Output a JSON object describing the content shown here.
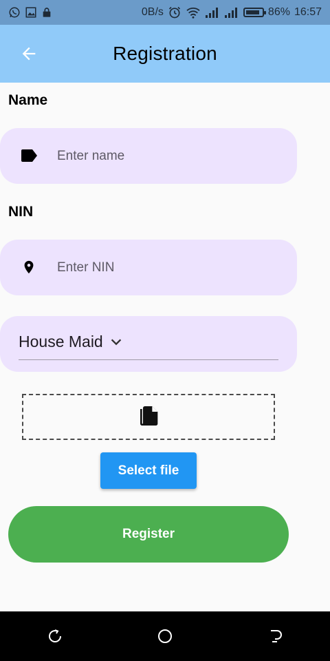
{
  "status_bar": {
    "network_speed": "0B/s",
    "battery_percent": "86%",
    "time": "16:57",
    "battery_level": 0.86
  },
  "app_bar": {
    "title": "Registration",
    "color": "#90caf9"
  },
  "form": {
    "name_label": "Name",
    "name_placeholder": "Enter name",
    "nin_label": "NIN",
    "nin_placeholder": "Enter NIN",
    "category_value": "House Maid",
    "select_file_label": "Select file",
    "register_label": "Register"
  },
  "colors": {
    "field_bg": "#ede3fe",
    "select_button": "#2196f3",
    "register_button": "#4caf50"
  },
  "icons": {
    "name_field": "label-tag-icon",
    "nin_field": "location-pin-icon",
    "file_box": "file-copy-icon"
  }
}
